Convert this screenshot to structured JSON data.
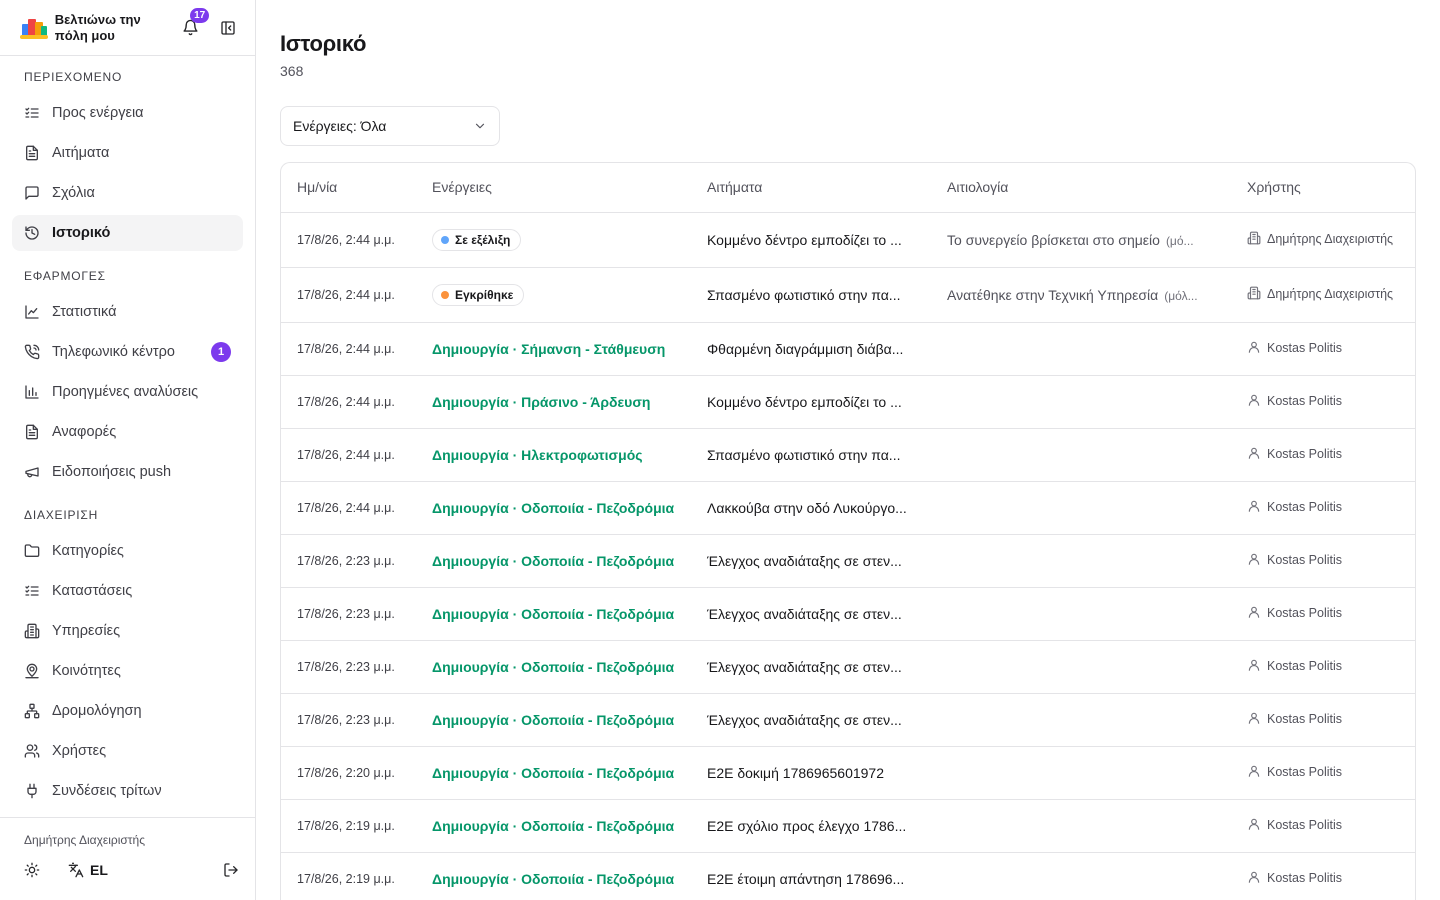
{
  "app": {
    "title": "Βελτιώνω την πόλη μου",
    "notifications_count": "17"
  },
  "sidebar": {
    "sections": [
      {
        "label": "ΠΕΡΙΕΧΟΜΕΝΟ",
        "items": [
          {
            "label": "Προς ενέργεια",
            "icon": "list-check-icon"
          },
          {
            "label": "Αιτήματα",
            "icon": "file-text-icon"
          },
          {
            "label": "Σχόλια",
            "icon": "message-square-icon"
          },
          {
            "label": "Ιστορικό",
            "icon": "history-icon",
            "active": true
          }
        ]
      },
      {
        "label": "ΕΦΑΡΜΟΓΕΣ",
        "items": [
          {
            "label": "Στατιστικά",
            "icon": "line-chart-icon"
          },
          {
            "label": "Τηλεφωνικό κέντρο",
            "icon": "phone-icon",
            "badge": "1"
          },
          {
            "label": "Προηγμένες αναλύσεις",
            "icon": "bar-chart-icon"
          },
          {
            "label": "Αναφορές",
            "icon": "file-text-icon"
          },
          {
            "label": "Ειδοποιήσεις push",
            "icon": "megaphone-icon"
          }
        ]
      },
      {
        "label": "ΔΙΑΧΕΙΡΙΣΗ",
        "items": [
          {
            "label": "Κατηγορίες",
            "icon": "folder-icon"
          },
          {
            "label": "Καταστάσεις",
            "icon": "list-check-icon"
          },
          {
            "label": "Υπηρεσίες",
            "icon": "building-icon"
          },
          {
            "label": "Κοινότητες",
            "icon": "map-pin-user-icon"
          },
          {
            "label": "Δρομολόγηση",
            "icon": "network-icon"
          },
          {
            "label": "Χρήστες",
            "icon": "users-icon"
          },
          {
            "label": "Συνδέσεις τρίτων",
            "icon": "plug-icon"
          }
        ]
      }
    ],
    "footer": {
      "user": "Δημήτρης Διαχειριστής",
      "lang": "EL"
    }
  },
  "main": {
    "title": "Ιστορικό",
    "count": "368",
    "filter": {
      "label": "Ενέργειες: Όλα"
    },
    "table": {
      "columns": [
        "Ημ/νία",
        "Ενέργειες",
        "Αιτήματα",
        "Αιτιολογία",
        "Χρήστης"
      ],
      "rows": [
        {
          "date": "17/8/26, 2:44 μ.μ.",
          "status": "Σε εξέλιξη",
          "status_color": "#60a5fa",
          "request": "Κομμένο δέντρο εμποδίζει το ...",
          "reason": "Το συνεργείο βρίσκεται στο σημείο",
          "reason_note": "(μό...",
          "user": "Δημήτρης Διαχειριστής",
          "user_type": "admin"
        },
        {
          "date": "17/8/26, 2:44 μ.μ.",
          "status": "Εγκρίθηκε",
          "status_color": "#fb923c",
          "request": "Σπασμένο φωτιστικό στην πα...",
          "reason": "Ανατέθηκε στην Τεχνική Υπηρεσία",
          "reason_note": "(μόλ...",
          "user": "Δημήτρης Διαχειριστής",
          "user_type": "admin"
        },
        {
          "date": "17/8/26, 2:44 μ.μ.",
          "action": "Δημιουργία · Σήμανση - Στάθμευση",
          "request": "Φθαρμένη διαγράμμιση διάβα...",
          "user": "Kostas Politis",
          "user_type": "citizen"
        },
        {
          "date": "17/8/26, 2:44 μ.μ.",
          "action": "Δημιουργία · Πράσινο - Άρδευση",
          "request": "Κομμένο δέντρο εμποδίζει το ...",
          "user": "Kostas Politis",
          "user_type": "citizen"
        },
        {
          "date": "17/8/26, 2:44 μ.μ.",
          "action": "Δημιουργία · Ηλεκτροφωτισμός",
          "request": "Σπασμένο φωτιστικό στην πα...",
          "user": "Kostas Politis",
          "user_type": "citizen"
        },
        {
          "date": "17/8/26, 2:44 μ.μ.",
          "action": "Δημιουργία · Οδοποιία - Πεζοδρόμια",
          "request": "Λακκούβα στην οδό Λυκούργο...",
          "user": "Kostas Politis",
          "user_type": "citizen"
        },
        {
          "date": "17/8/26, 2:23 μ.μ.",
          "action": "Δημιουργία · Οδοποιία - Πεζοδρόμια",
          "request": "Έλεγχος αναδιάταξης σε στεν...",
          "user": "Kostas Politis",
          "user_type": "citizen"
        },
        {
          "date": "17/8/26, 2:23 μ.μ.",
          "action": "Δημιουργία · Οδοποιία - Πεζοδρόμια",
          "request": "Έλεγχος αναδιάταξης σε στεν...",
          "user": "Kostas Politis",
          "user_type": "citizen"
        },
        {
          "date": "17/8/26, 2:23 μ.μ.",
          "action": "Δημιουργία · Οδοποιία - Πεζοδρόμια",
          "request": "Έλεγχος αναδιάταξης σε στεν...",
          "user": "Kostas Politis",
          "user_type": "citizen"
        },
        {
          "date": "17/8/26, 2:23 μ.μ.",
          "action": "Δημιουργία · Οδοποιία - Πεζοδρόμια",
          "request": "Έλεγχος αναδιάταξης σε στεν...",
          "user": "Kostas Politis",
          "user_type": "citizen"
        },
        {
          "date": "17/8/26, 2:20 μ.μ.",
          "action": "Δημιουργία · Οδοποιία - Πεζοδρόμια",
          "request": "E2E δοκιμή 1786965601972",
          "user": "Kostas Politis",
          "user_type": "citizen"
        },
        {
          "date": "17/8/26, 2:19 μ.μ.",
          "action": "Δημιουργία · Οδοποιία - Πεζοδρόμια",
          "request": "E2E σχόλιο προς έλεγχο 1786...",
          "user": "Kostas Politis",
          "user_type": "citizen"
        },
        {
          "date": "17/8/26, 2:19 μ.μ.",
          "action": "Δημιουργία · Οδοποιία - Πεζοδρόμια",
          "request": "E2E έτοιμη απάντηση 178696...",
          "user": "Kostas Politis",
          "user_type": "citizen"
        }
      ]
    }
  },
  "colors": {
    "accent": "#7c3aed",
    "action_green": "#059669",
    "border": "#e4e4e7"
  }
}
